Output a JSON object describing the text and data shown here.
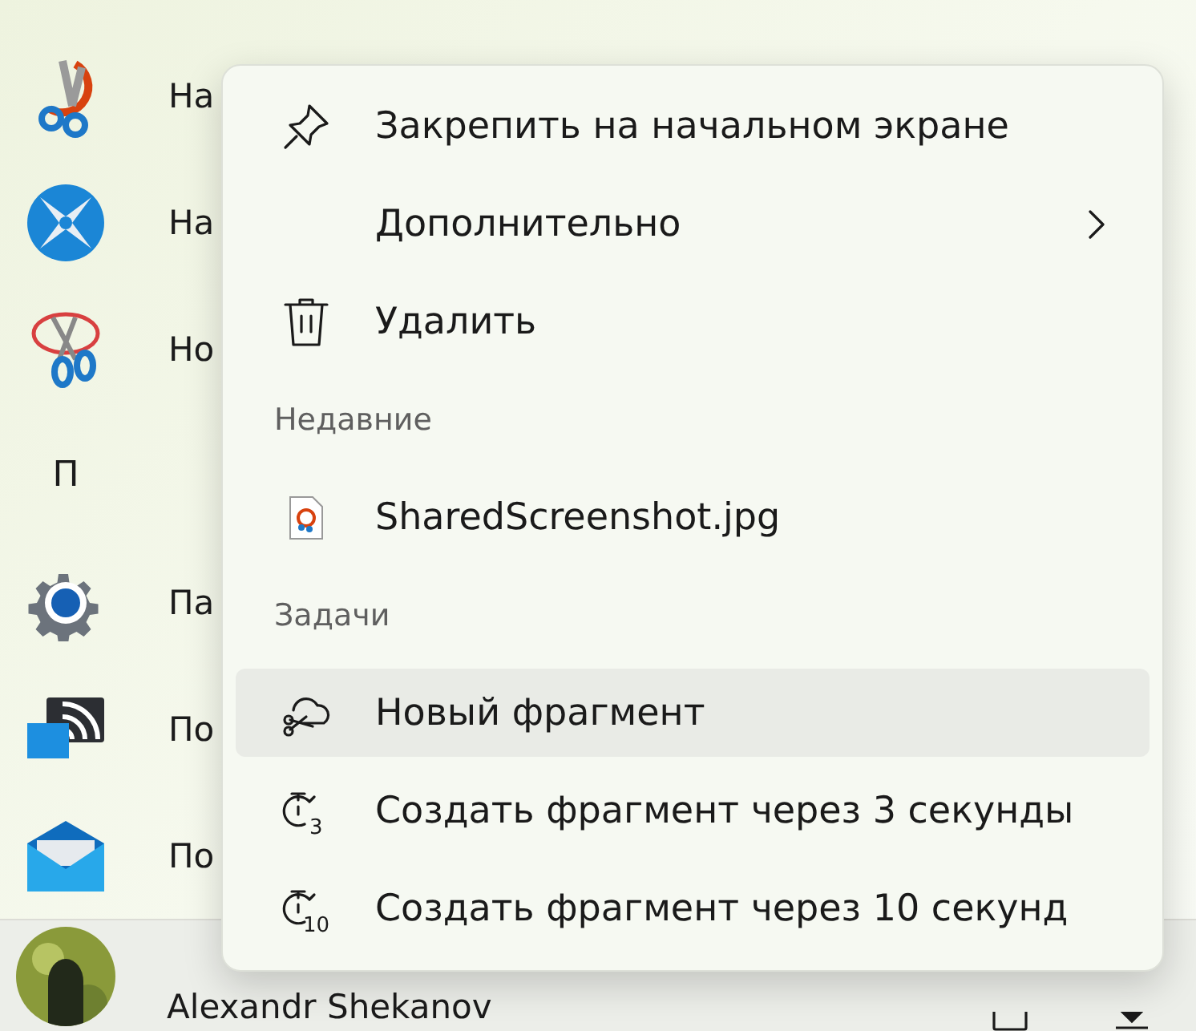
{
  "app_list": [
    {
      "kind": "app",
      "name": "На"
    },
    {
      "kind": "app",
      "name": "На"
    },
    {
      "kind": "app",
      "name": "Но"
    },
    {
      "kind": "letter",
      "name": "П"
    },
    {
      "kind": "app",
      "name": "Па"
    },
    {
      "kind": "app",
      "name": "По"
    },
    {
      "kind": "app",
      "name": "По"
    }
  ],
  "user": {
    "name": "Alexandr Shekanov"
  },
  "context_menu": {
    "items": [
      {
        "kind": "item",
        "label": "Закрепить на начальном экране",
        "submenu": false,
        "selected": false
      },
      {
        "kind": "item",
        "label": "Дополнительно",
        "submenu": true,
        "selected": false
      },
      {
        "kind": "item",
        "label": "Удалить",
        "submenu": false,
        "selected": false
      },
      {
        "kind": "header",
        "label": "Недавние"
      },
      {
        "kind": "item",
        "label": "SharedScreenshot.jpg",
        "submenu": false,
        "selected": false
      },
      {
        "kind": "header",
        "label": "Задачи"
      },
      {
        "kind": "item",
        "label": "Новый фрагмент",
        "submenu": false,
        "selected": true
      },
      {
        "kind": "item",
        "label": "Создать фрагмент через 3 секунды",
        "icon_text": "3",
        "submenu": false,
        "selected": false
      },
      {
        "kind": "item",
        "label": "Создать фрагмент через 10 секунд",
        "icon_text": "10",
        "submenu": false,
        "selected": false
      }
    ]
  }
}
